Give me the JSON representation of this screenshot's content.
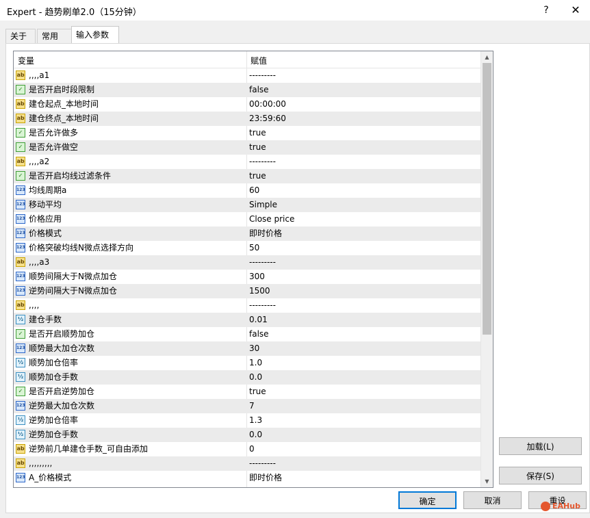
{
  "window": {
    "title": "Expert - 趋势刷单2.0（15分钟）",
    "help": "?",
    "close": "✕"
  },
  "tabs": [
    {
      "label": "关于"
    },
    {
      "label": "常用"
    },
    {
      "label": "输入参数"
    }
  ],
  "table": {
    "headers": {
      "variable": "变量",
      "value": "赋值"
    },
    "rows": [
      {
        "icon": "ab",
        "name": ",,,,a1",
        "value": "---------"
      },
      {
        "icon": "bool",
        "name": "是否开启时段限制",
        "value": "false"
      },
      {
        "icon": "ab",
        "name": "建仓起点_本地时间",
        "value": "00:00:00"
      },
      {
        "icon": "ab",
        "name": "建仓终点_本地时间",
        "value": "23:59:60"
      },
      {
        "icon": "bool",
        "name": "是否允许做多",
        "value": "true"
      },
      {
        "icon": "bool",
        "name": "是否允许做空",
        "value": "true"
      },
      {
        "icon": "ab",
        "name": ",,,,a2",
        "value": "---------"
      },
      {
        "icon": "bool",
        "name": "是否开启均线过滤条件",
        "value": "true"
      },
      {
        "icon": "int",
        "name": "均线周期a",
        "value": "60"
      },
      {
        "icon": "int",
        "name": "移动平均",
        "value": "Simple"
      },
      {
        "icon": "int",
        "name": "价格应用",
        "value": "Close price"
      },
      {
        "icon": "int",
        "name": "价格模式",
        "value": "即时价格"
      },
      {
        "icon": "int",
        "name": "价格突破均线N微点选择方向",
        "value": "50"
      },
      {
        "icon": "ab",
        "name": ",,,,a3",
        "value": "---------"
      },
      {
        "icon": "int",
        "name": "顺势间隔大于N微点加仓",
        "value": "300"
      },
      {
        "icon": "int",
        "name": "逆势间隔大于N微点加仓",
        "value": "1500"
      },
      {
        "icon": "ab",
        "name": ",,,,",
        "value": "---------"
      },
      {
        "icon": "dbl",
        "name": "建仓手数",
        "value": "0.01"
      },
      {
        "icon": "bool",
        "name": "是否开启顺势加仓",
        "value": "false"
      },
      {
        "icon": "int",
        "name": "顺势最大加仓次数",
        "value": "30"
      },
      {
        "icon": "dbl",
        "name": "顺势加仓倍率",
        "value": "1.0"
      },
      {
        "icon": "dbl",
        "name": "顺势加仓手数",
        "value": "0.0"
      },
      {
        "icon": "bool",
        "name": "是否开启逆势加仓",
        "value": "true"
      },
      {
        "icon": "int",
        "name": "逆势最大加仓次数",
        "value": "7"
      },
      {
        "icon": "dbl",
        "name": "逆势加仓倍率",
        "value": "1.3"
      },
      {
        "icon": "dbl",
        "name": "逆势加仓手数",
        "value": "0.0"
      },
      {
        "icon": "ab",
        "name": "逆势前几单建仓手数_可自由添加",
        "value": "0"
      },
      {
        "icon": "ab",
        "name": ",,,,,,,,,",
        "value": "---------"
      },
      {
        "icon": "int",
        "name": "A_价格模式",
        "value": "即时价格"
      }
    ]
  },
  "icon_glyphs": {
    "ab": "ab",
    "bool": "✓",
    "int": "123",
    "dbl": "½"
  },
  "buttons": {
    "load": "加载(L)",
    "save": "保存(S)",
    "ok": "确定",
    "cancel": "取消",
    "reset": "重设"
  },
  "watermark": "EAHub"
}
